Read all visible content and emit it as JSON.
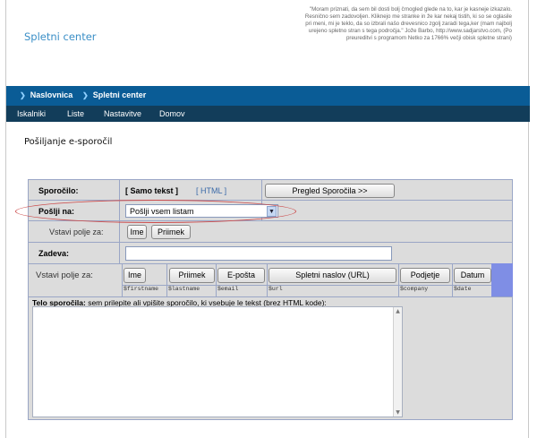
{
  "header": {
    "brand": "Spletni center",
    "quote": "\"Moram priznati, da sem bil dosti bolj črnogled glede na to, kar je kasneje izkazalo. Resnično sem zadovoljen. Kliknejo me stranke in že kar nekaj tistih, ki so se oglasile pri meni, mi je teklo, da so izbrali našo drevesnico zgolj zaradi tega,ker (mam najbolj urejeno spletno stran s tega področja.\" Jože Barbo, http://www.sadjarstvo.com, (Po preureditvi s programom Netko za 1766% večji obisk spletne strani)"
  },
  "breadcrumbs": [
    "Naslovnica",
    "Spletni center"
  ],
  "nav": [
    "Iskalniki",
    "Liste",
    "Nastavitve",
    "Domov"
  ],
  "page_title": "Pošiljanje e-sporočil",
  "form": {
    "message_label": "Sporočilo:",
    "plain_text": "[ Samo tekst ]",
    "html_link": "[ HTML ]",
    "preview_button": "Pregled Sporočila >>",
    "send_to_label": "Pošlji na:",
    "send_to_value": "Pošlji vsem listam",
    "insert_field_label": "Vstavi polje za:",
    "insert_buttons_small": [
      "Ime",
      "Priimek"
    ],
    "subject_label": "Zadeva:",
    "subject_value": "",
    "insert_field_label2": "Vstavi polje za:",
    "insert_buttons": [
      "Ime",
      "Priimek",
      "E-pošta",
      "Spletni naslov (URL)",
      "Podjetje",
      "Datum"
    ],
    "variables": [
      "$firstname",
      "$lastname",
      "$email",
      "$url",
      "$company",
      "$date"
    ],
    "body_label": "Telo sporočila:",
    "body_hint": "sem prilepite ali vpišite sporočilo, ki vsebuje le tekst (brez HTML kode):",
    "body_value": ""
  },
  "colors": {
    "brand": "#3b8fc7",
    "crumb_bar": "#0a5c96",
    "nav_bar": "#123d5a",
    "highlight": "#cc4b4b"
  }
}
